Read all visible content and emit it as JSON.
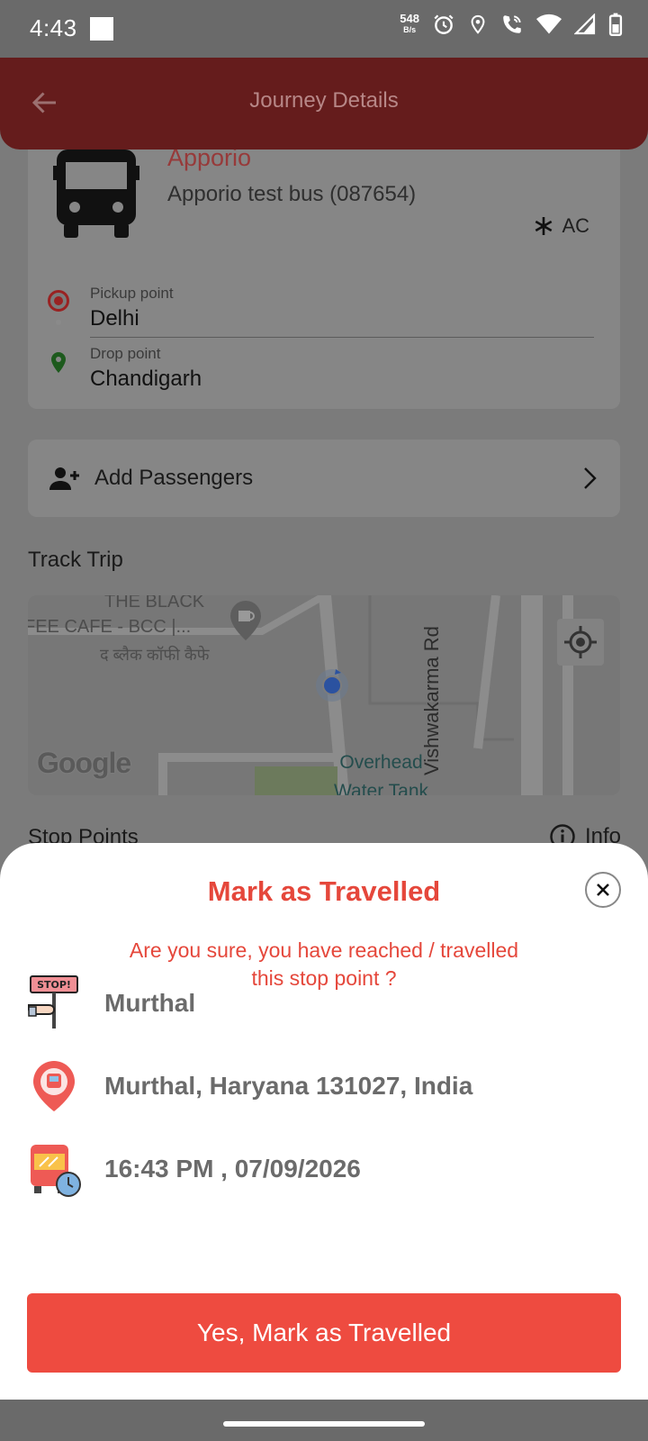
{
  "status_bar": {
    "time": "4:43",
    "net_speed": "548",
    "net_unit": "B/s",
    "icons": [
      "alarm-icon",
      "location-icon",
      "wifi-call-icon",
      "wifi-icon",
      "signal-icon",
      "battery-icon"
    ]
  },
  "app_bar": {
    "title": "Journey Details",
    "back_icon": "arrow-left-icon"
  },
  "journey": {
    "operator": "Apporio",
    "bus_name": "Apporio test bus (087654)",
    "ac_label": "AC",
    "pickup_label": "Pickup point",
    "pickup_value": "Delhi",
    "drop_label": "Drop point",
    "drop_value": "Chandigarh"
  },
  "passengers": {
    "label": "Add Passengers"
  },
  "track": {
    "title": "Track Trip",
    "map_labels": [
      "THE BLACK",
      "FEE CAFE - BCC |...",
      "द ब्लैक कॉफी कैफे",
      "Overhead",
      "Water Tank",
      "Vishwakarma Rd"
    ],
    "google": "Google"
  },
  "stop_points": {
    "title": "Stop Points",
    "info_label": "Info"
  },
  "sheet": {
    "title": "Mark as Travelled",
    "message_line1": "Are you sure, you have reached / travelled",
    "message_line2": "this stop point ?",
    "stop_name": "Murthal",
    "address": "Murthal, Haryana 131027, India",
    "datetime": "16:43 PM , 07/09/2026",
    "stop_sign_text": "STOP!",
    "confirm_button": "Yes, Mark as Travelled"
  },
  "colors": {
    "accent": "#ee4b40",
    "title_red": "#e5473b",
    "app_bar": "#651c1c"
  }
}
